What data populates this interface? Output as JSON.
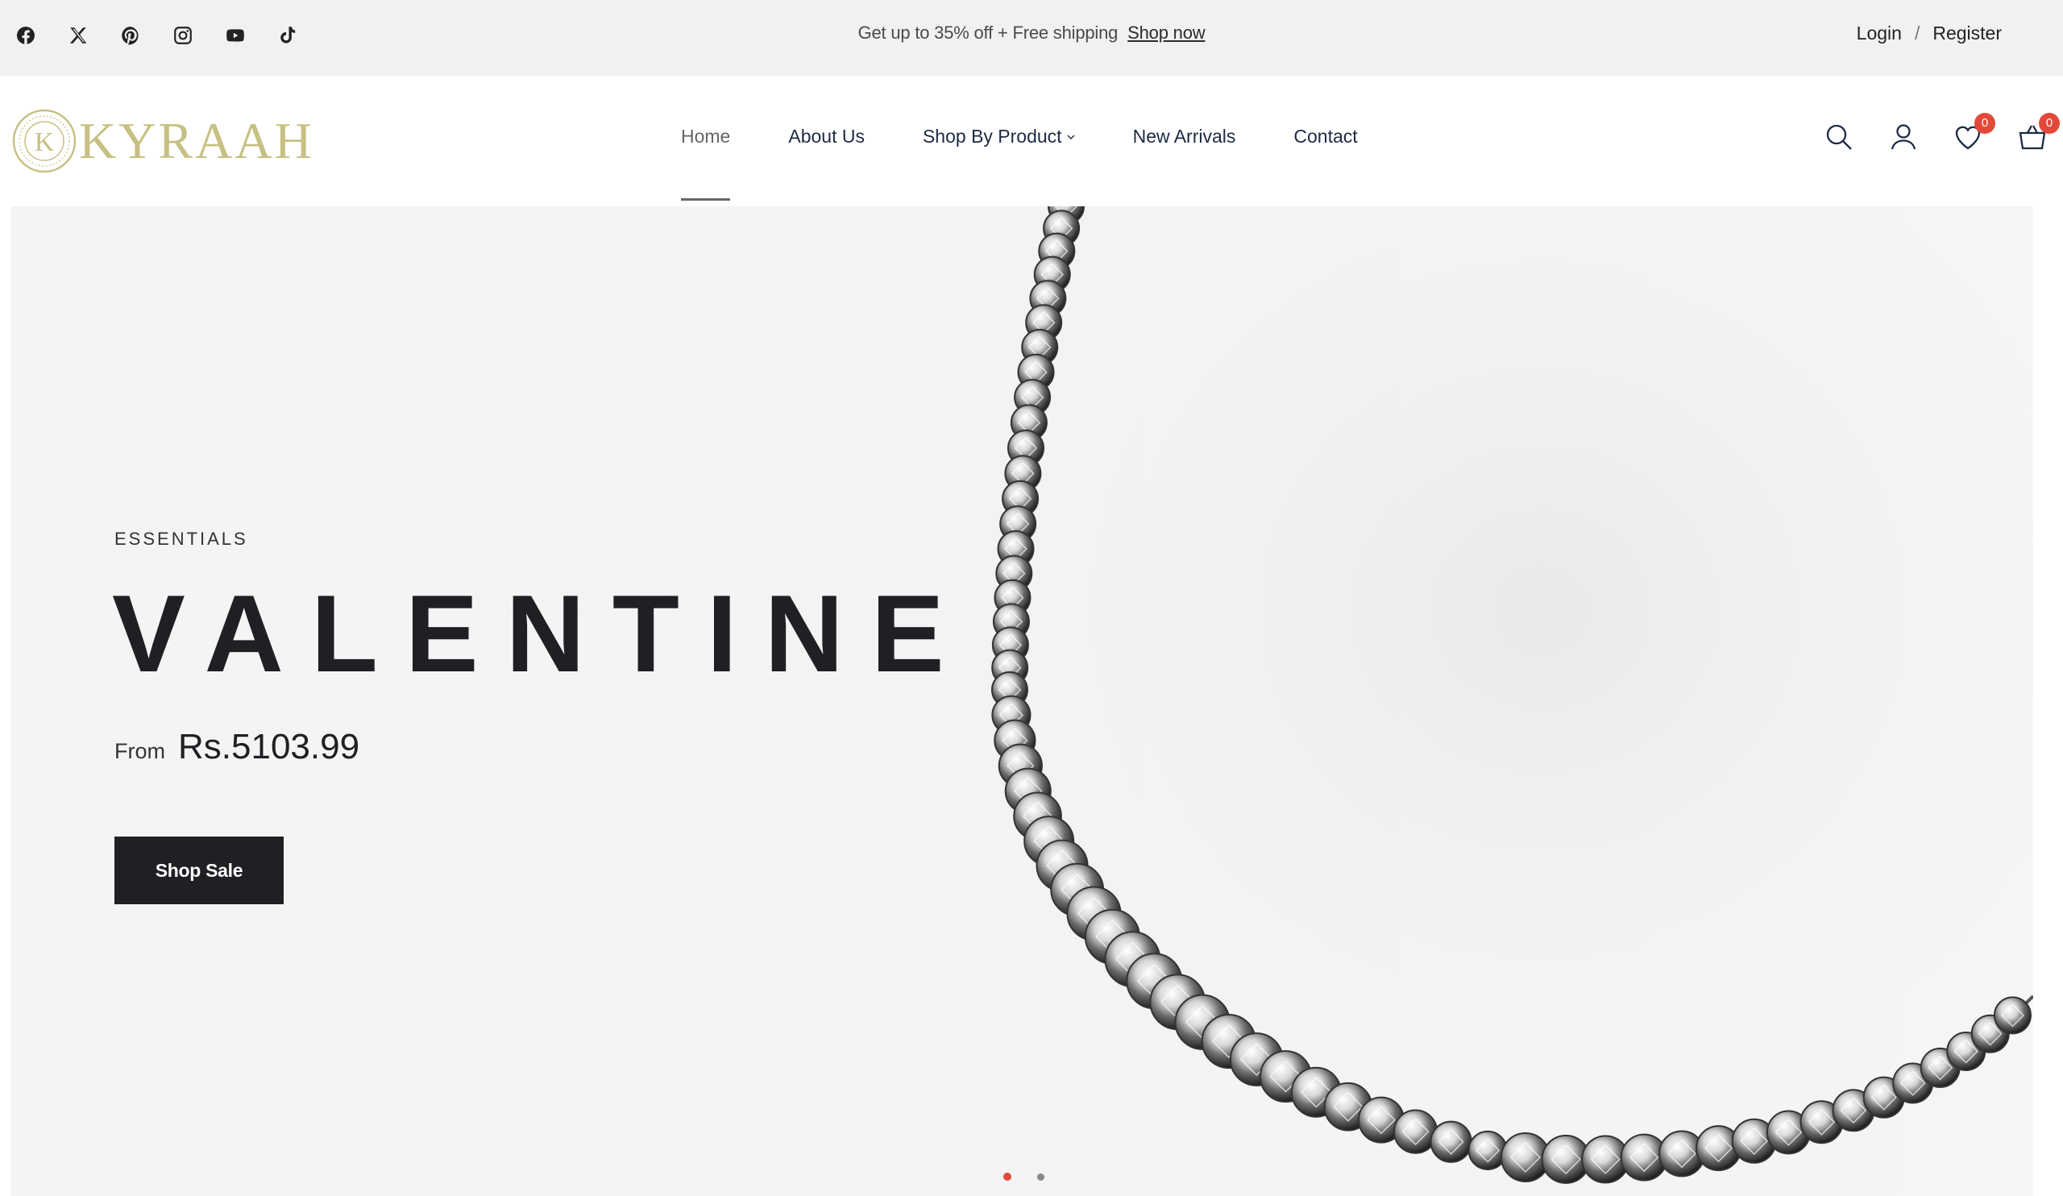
{
  "topbar": {
    "social": [
      {
        "icon": "facebook-icon"
      },
      {
        "icon": "x-twitter-icon"
      },
      {
        "icon": "pinterest-icon"
      },
      {
        "icon": "instagram-icon"
      },
      {
        "icon": "youtube-icon"
      },
      {
        "icon": "tiktok-icon"
      }
    ],
    "promo_text": "Get up to 35% off + Free shipping",
    "promo_link": "Shop now",
    "login": "Login",
    "separator": "/",
    "register": "Register"
  },
  "header": {
    "logo_text": "KYRAAH",
    "logo_monogram": "K",
    "nav": [
      {
        "label": "Home",
        "active": true
      },
      {
        "label": "About Us"
      },
      {
        "label": "Shop By Product",
        "dropdown": true
      },
      {
        "label": "New Arrivals"
      },
      {
        "label": "Contact"
      }
    ],
    "wishlist_count": "0",
    "cart_count": "0"
  },
  "hero": {
    "eyebrow": "ESSENTIALS",
    "headline": "VALENTINE",
    "price_prefix": "From",
    "price": "Rs.5103.99",
    "cta_label": "Shop Sale",
    "slides_total": 2,
    "active_slide": 1
  },
  "colors": {
    "accent": "#e2493a",
    "logo_gold": "#c7c083",
    "dark": "#1f1f24",
    "nav_text": "#1d2a44"
  }
}
